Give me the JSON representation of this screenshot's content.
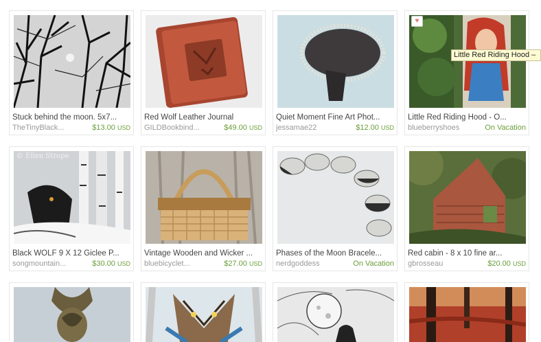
{
  "listings": [
    {
      "title": "Stuck behind the moon. 5x7...",
      "shop": "TheTinyBlack...",
      "price": "$13.00",
      "currency": "USD"
    },
    {
      "title": "Red Wolf Leather Journal",
      "shop": "GILDBookbind...",
      "price": "$49.00",
      "currency": "USD"
    },
    {
      "title": "Quiet Moment Fine Art Phot...",
      "shop": "jessamae22",
      "price": "$12.00",
      "currency": "USD"
    },
    {
      "title": "Little Red Riding Hood - O...",
      "shop": "blueberryshoes",
      "status": "On Vacation"
    },
    {
      "title": "Black WOLF 9 X 12 Giclee P...",
      "shop": "songmountain...",
      "price": "$30.00",
      "currency": "USD"
    },
    {
      "title": "Vintage Wooden and Wicker ...",
      "shop": "bluebicyclet...",
      "price": "$27.00",
      "currency": "USD"
    },
    {
      "title": "Phases of the Moon Bracele...",
      "shop": "nerdgoddess",
      "status": "On Vacation"
    },
    {
      "title": "Red cabin - 8 x 10 fine ar...",
      "shop": "gbrosseau",
      "price": "$20.00",
      "currency": "USD"
    }
  ],
  "tooltip": "Little Red Riding Hood –",
  "watermark": "© Ellen Strope",
  "favorite_icon": "heart-icon"
}
